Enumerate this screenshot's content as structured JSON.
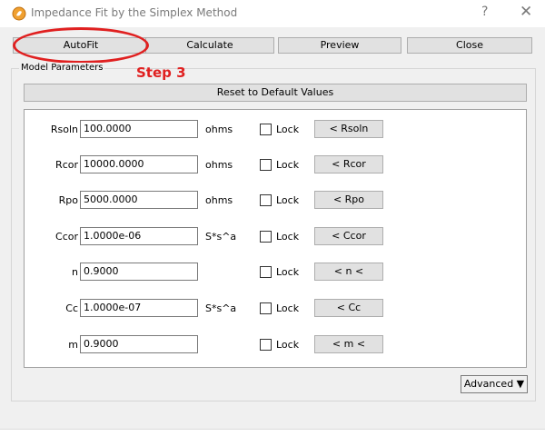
{
  "window": {
    "title": "Impedance Fit by the Simplex Method",
    "help_glyph": "?",
    "close_glyph": "✕"
  },
  "toolbar": {
    "autofit": "AutoFit",
    "calculate": "Calculate",
    "preview": "Preview",
    "close": "Close"
  },
  "annotation": {
    "step_text": "Step 3",
    "color": "#e02020"
  },
  "model_parameters": {
    "group_label": "Model Parameters",
    "reset_label": "Reset to Default Values",
    "lock_label": "Lock",
    "params": [
      {
        "name": "Rsoln",
        "value": "100.0000",
        "unit": "ohms",
        "button": "< Rsoln"
      },
      {
        "name": "Rcor",
        "value": "10000.0000",
        "unit": "ohms",
        "button": "< Rcor"
      },
      {
        "name": "Rpo",
        "value": "5000.0000",
        "unit": "ohms",
        "button": "< Rpo"
      },
      {
        "name": "Ccor",
        "value": "1.0000e-06",
        "unit": "S*s^a",
        "button": "< Ccor"
      },
      {
        "name": "n",
        "value": "0.9000",
        "unit": "",
        "button": "< n <"
      },
      {
        "name": "Cc",
        "value": "1.0000e-07",
        "unit": "S*s^a",
        "button": "< Cc"
      },
      {
        "name": "m",
        "value": "0.9000",
        "unit": "",
        "button": "< m <"
      }
    ],
    "advanced_label": "Advanced ▼"
  }
}
